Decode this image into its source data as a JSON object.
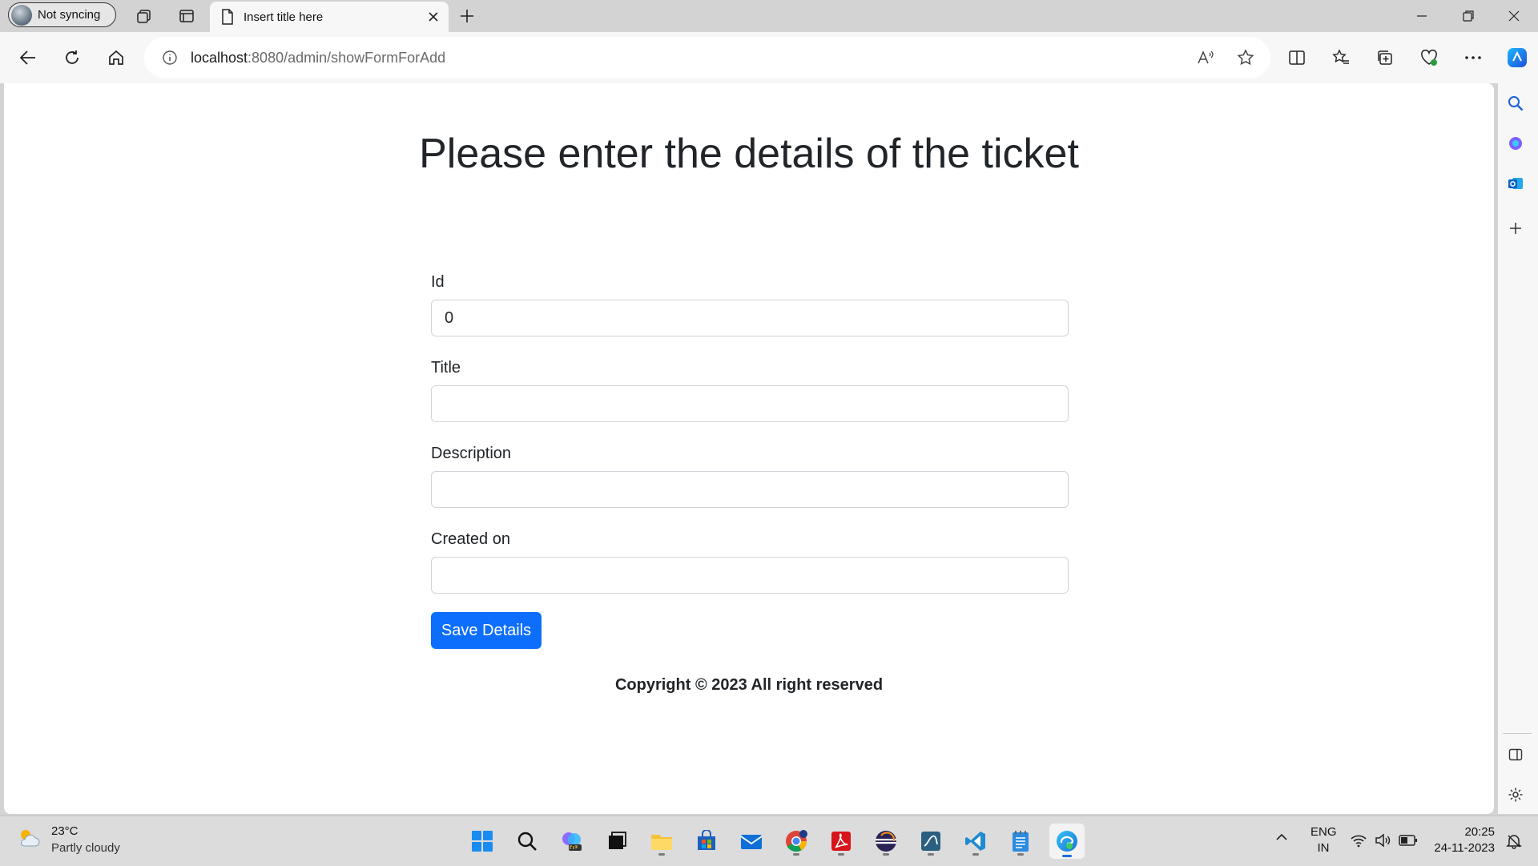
{
  "browser": {
    "profile_label": "Not syncing",
    "tab_title": "Insert title here",
    "url_host": "localhost",
    "url_path": ":8080/admin/showFormForAdd"
  },
  "form": {
    "heading": "Please enter the details of the ticket",
    "fields": [
      {
        "label": "Id",
        "value": "0"
      },
      {
        "label": "Title",
        "value": ""
      },
      {
        "label": "Description",
        "value": ""
      },
      {
        "label": "Created on",
        "value": ""
      }
    ],
    "submit_label": "Save Details",
    "footer": "Copyright © 2023 All right reserved"
  },
  "colors": {
    "primary_button": "#0d6efd",
    "text": "#212529"
  },
  "taskbar": {
    "weather_temp": "23°C",
    "weather_desc": "Partly cloudy",
    "lang_line1": "ENG",
    "lang_line2": "IN",
    "time": "20:25",
    "date": "24-11-2023"
  }
}
